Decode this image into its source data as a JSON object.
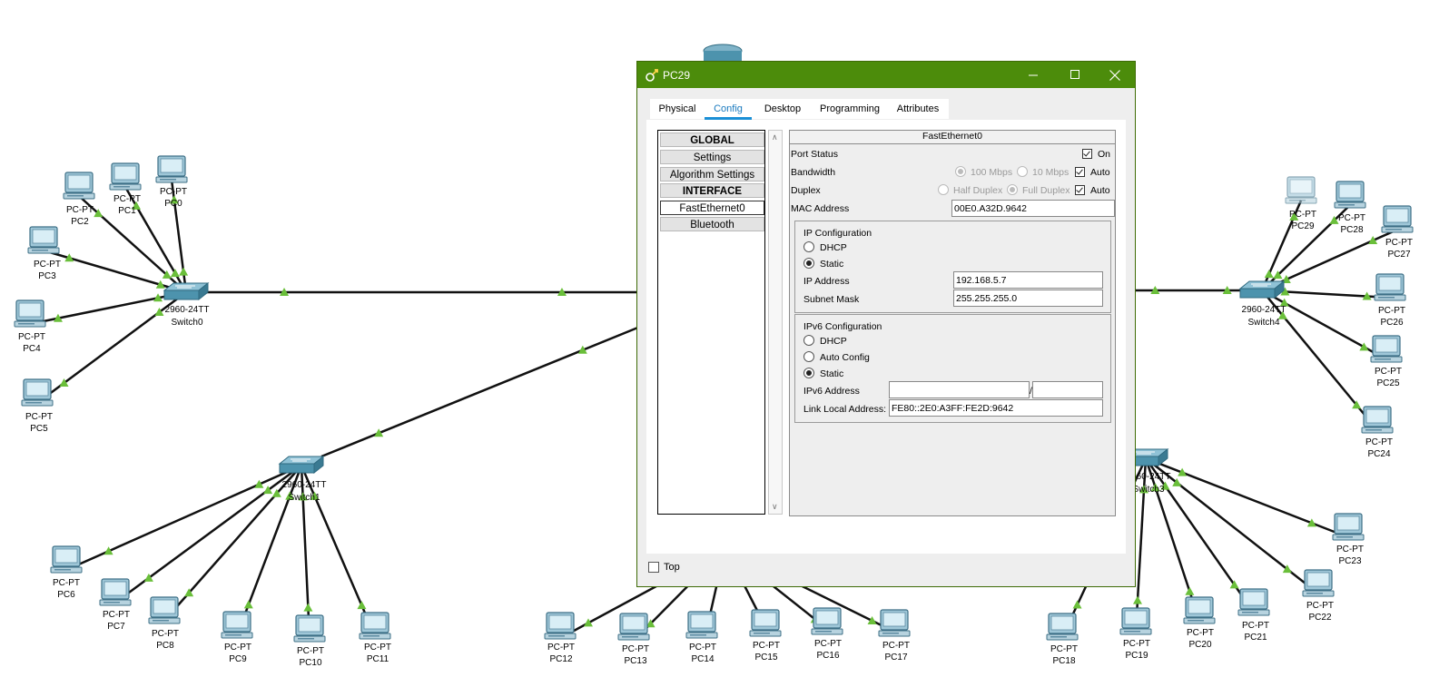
{
  "topology": {
    "switches": [
      {
        "model": "2960-24TT",
        "name": "Switch0"
      },
      {
        "model": "2960-24TT",
        "name": "Switch1"
      },
      {
        "model": "2960-24TT",
        "name": "Switch4"
      },
      {
        "model": "2960-24TT",
        "name": "Switch3"
      }
    ],
    "pcs": [
      {
        "type": "PC-PT",
        "name": "PC0"
      },
      {
        "type": "PC-PT",
        "name": "PC1"
      },
      {
        "type": "PC-PT",
        "name": "PC2"
      },
      {
        "type": "PC-PT",
        "name": "PC3"
      },
      {
        "type": "PC-PT",
        "name": "PC4"
      },
      {
        "type": "PC-PT",
        "name": "PC5"
      },
      {
        "type": "PC-PT",
        "name": "PC6"
      },
      {
        "type": "PC-PT",
        "name": "PC7"
      },
      {
        "type": "PC-PT",
        "name": "PC8"
      },
      {
        "type": "PC-PT",
        "name": "PC9"
      },
      {
        "type": "PC-PT",
        "name": "PC10"
      },
      {
        "type": "PC-PT",
        "name": "PC11"
      },
      {
        "type": "PC-PT",
        "name": "PC12"
      },
      {
        "type": "PC-PT",
        "name": "PC13"
      },
      {
        "type": "PC-PT",
        "name": "PC14"
      },
      {
        "type": "PC-PT",
        "name": "PC15"
      },
      {
        "type": "PC-PT",
        "name": "PC16"
      },
      {
        "type": "PC-PT",
        "name": "PC17"
      },
      {
        "type": "PC-PT",
        "name": "PC18"
      },
      {
        "type": "PC-PT",
        "name": "PC19"
      },
      {
        "type": "PC-PT",
        "name": "PC20"
      },
      {
        "type": "PC-PT",
        "name": "PC21"
      },
      {
        "type": "PC-PT",
        "name": "PC22"
      },
      {
        "type": "PC-PT",
        "name": "PC23"
      },
      {
        "type": "PC-PT",
        "name": "PC24"
      },
      {
        "type": "PC-PT",
        "name": "PC25"
      },
      {
        "type": "PC-PT",
        "name": "PC26"
      },
      {
        "type": "PC-PT",
        "name": "PC27"
      },
      {
        "type": "PC-PT",
        "name": "PC28"
      },
      {
        "type": "PC-PT",
        "name": "PC29"
      }
    ]
  },
  "window": {
    "title": "PC29",
    "icon": "packet-tracer-icon",
    "controls": [
      "minimize-icon",
      "maximize-icon",
      "close-icon"
    ]
  },
  "tabs": [
    "Physical",
    "Config",
    "Desktop",
    "Programming",
    "Attributes"
  ],
  "active_tab": "Config",
  "sidebar": {
    "items": [
      "GLOBAL",
      "Settings",
      "Algorithm Settings",
      "INTERFACE",
      "FastEthernet0",
      "Bluetooth"
    ],
    "selected": "FastEthernet0"
  },
  "interface": {
    "header": "FastEthernet0",
    "port_status_label": "Port Status",
    "port_status_on": "On",
    "bandwidth_label": "Bandwidth",
    "bandwidth_100": "100 Mbps",
    "bandwidth_10": "10 Mbps",
    "bandwidth_auto": "Auto",
    "duplex_label": "Duplex",
    "duplex_half": "Half Duplex",
    "duplex_full": "Full Duplex",
    "duplex_auto": "Auto",
    "mac_label": "MAC Address",
    "mac_value": "00E0.A32D.9642",
    "ipv4": {
      "title": "IP Configuration",
      "dhcp": "DHCP",
      "static": "Static",
      "ip_label": "IP Address",
      "ip_value": "192.168.5.7",
      "mask_label": "Subnet Mask",
      "mask_value": "255.255.255.0"
    },
    "ipv6": {
      "title": "IPv6 Configuration",
      "dhcp": "DHCP",
      "auto": "Auto Config",
      "static": "Static",
      "addr_label": "IPv6 Address",
      "addr_value": "",
      "prefix_sep": "/",
      "prefix_value": "",
      "lla_label": "Link Local Address:",
      "lla_value": "FE80::2E0:A3FF:FE2D:9642"
    }
  },
  "footer": {
    "top_label": "Top"
  },
  "colors": {
    "titlebar": "#4c8c0b",
    "active_tab": "#1a8fd6",
    "link_marker": "#6abf3a"
  }
}
